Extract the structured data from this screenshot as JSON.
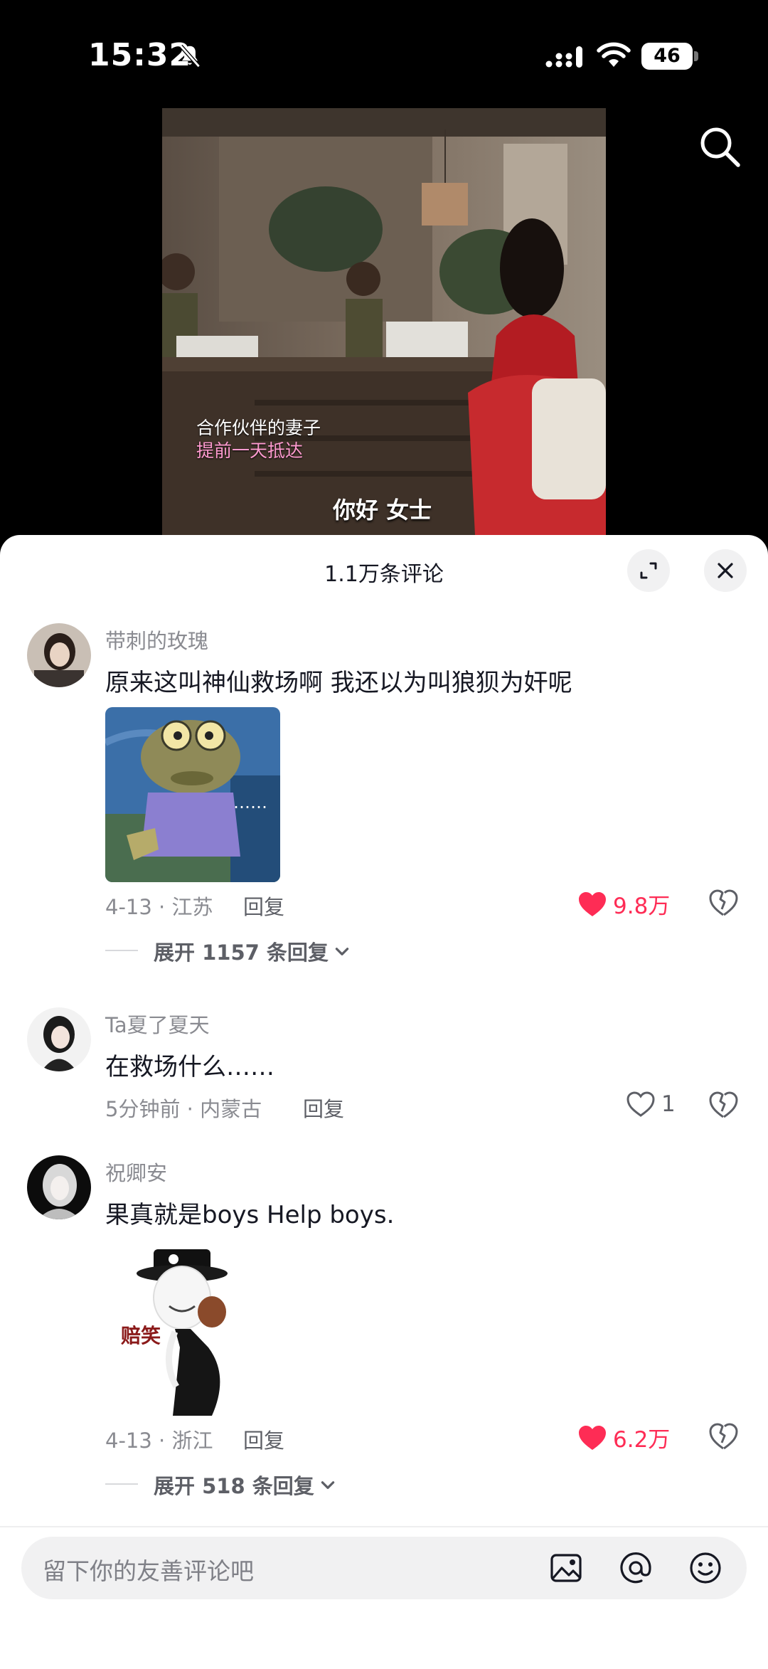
{
  "status_bar": {
    "time": "15:32",
    "battery": "46"
  },
  "video": {
    "subtitle_line1": "合作伙伴的妻子",
    "subtitle_line2": "提前一天抵达",
    "caption": "你好 女士"
  },
  "sheet": {
    "title": "1.1万条评论"
  },
  "comments": [
    {
      "username": "带刺的玫瑰",
      "text": "原来这叫神仙救场啊  我还以为叫狼狈为奸呢",
      "sticker_text": "……",
      "meta": "4-13 · 江苏",
      "reply_label": "回复",
      "likes": "9.8万",
      "liked": true,
      "expand_label": "展开 1157 条回复"
    },
    {
      "username": "Ta夏了夏天",
      "text": "在救场什么……",
      "meta": "5分钟前 · 内蒙古",
      "reply_label": "回复",
      "likes": "1",
      "liked": false
    },
    {
      "username": "祝卿安",
      "text": "果真就是boys Help boys.",
      "sticker_text": "赔笑",
      "meta": "4-13 · 浙江",
      "reply_label": "回复",
      "likes": "6.2万",
      "liked": true,
      "expand_label": "展开 518 条回复"
    }
  ],
  "input": {
    "placeholder": "留下你的友善评论吧"
  },
  "colors": {
    "like_red": "#fe2c55",
    "text_primary": "#161823",
    "text_secondary": "#8a8b91"
  }
}
